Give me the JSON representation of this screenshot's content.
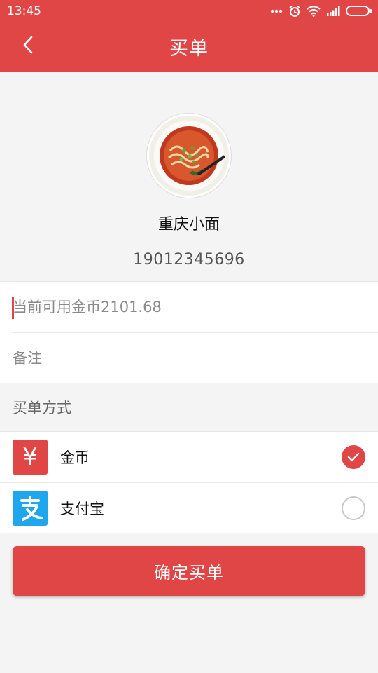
{
  "status_bar": {
    "time": "13:45",
    "icons": [
      "more-dots-icon",
      "alarm-icon",
      "wifi-icon",
      "signal-icon",
      "battery-icon"
    ]
  },
  "app_bar": {
    "title": "买单",
    "back_icon": "chevron-left-icon",
    "background": "#e14646"
  },
  "shop": {
    "avatar_icon": "noodle-bowl-image",
    "name": "重庆小面",
    "phone": "19012345696"
  },
  "form": {
    "coins_placeholder": "当前可用金币2101.68",
    "note_placeholder": "备注"
  },
  "payment": {
    "section_label": "买单方式",
    "methods": [
      {
        "label": "金币",
        "icon": "yuan-coin-icon",
        "icon_glyph": "¥",
        "selected": true
      },
      {
        "label": "支付宝",
        "icon": "alipay-icon",
        "icon_glyph": "支",
        "selected": false
      }
    ]
  },
  "confirm_button": {
    "label": "确定买单"
  },
  "colors": {
    "accent": "#e14646",
    "alipay_blue": "#1ea7ec",
    "background": "#f4f4f4"
  }
}
